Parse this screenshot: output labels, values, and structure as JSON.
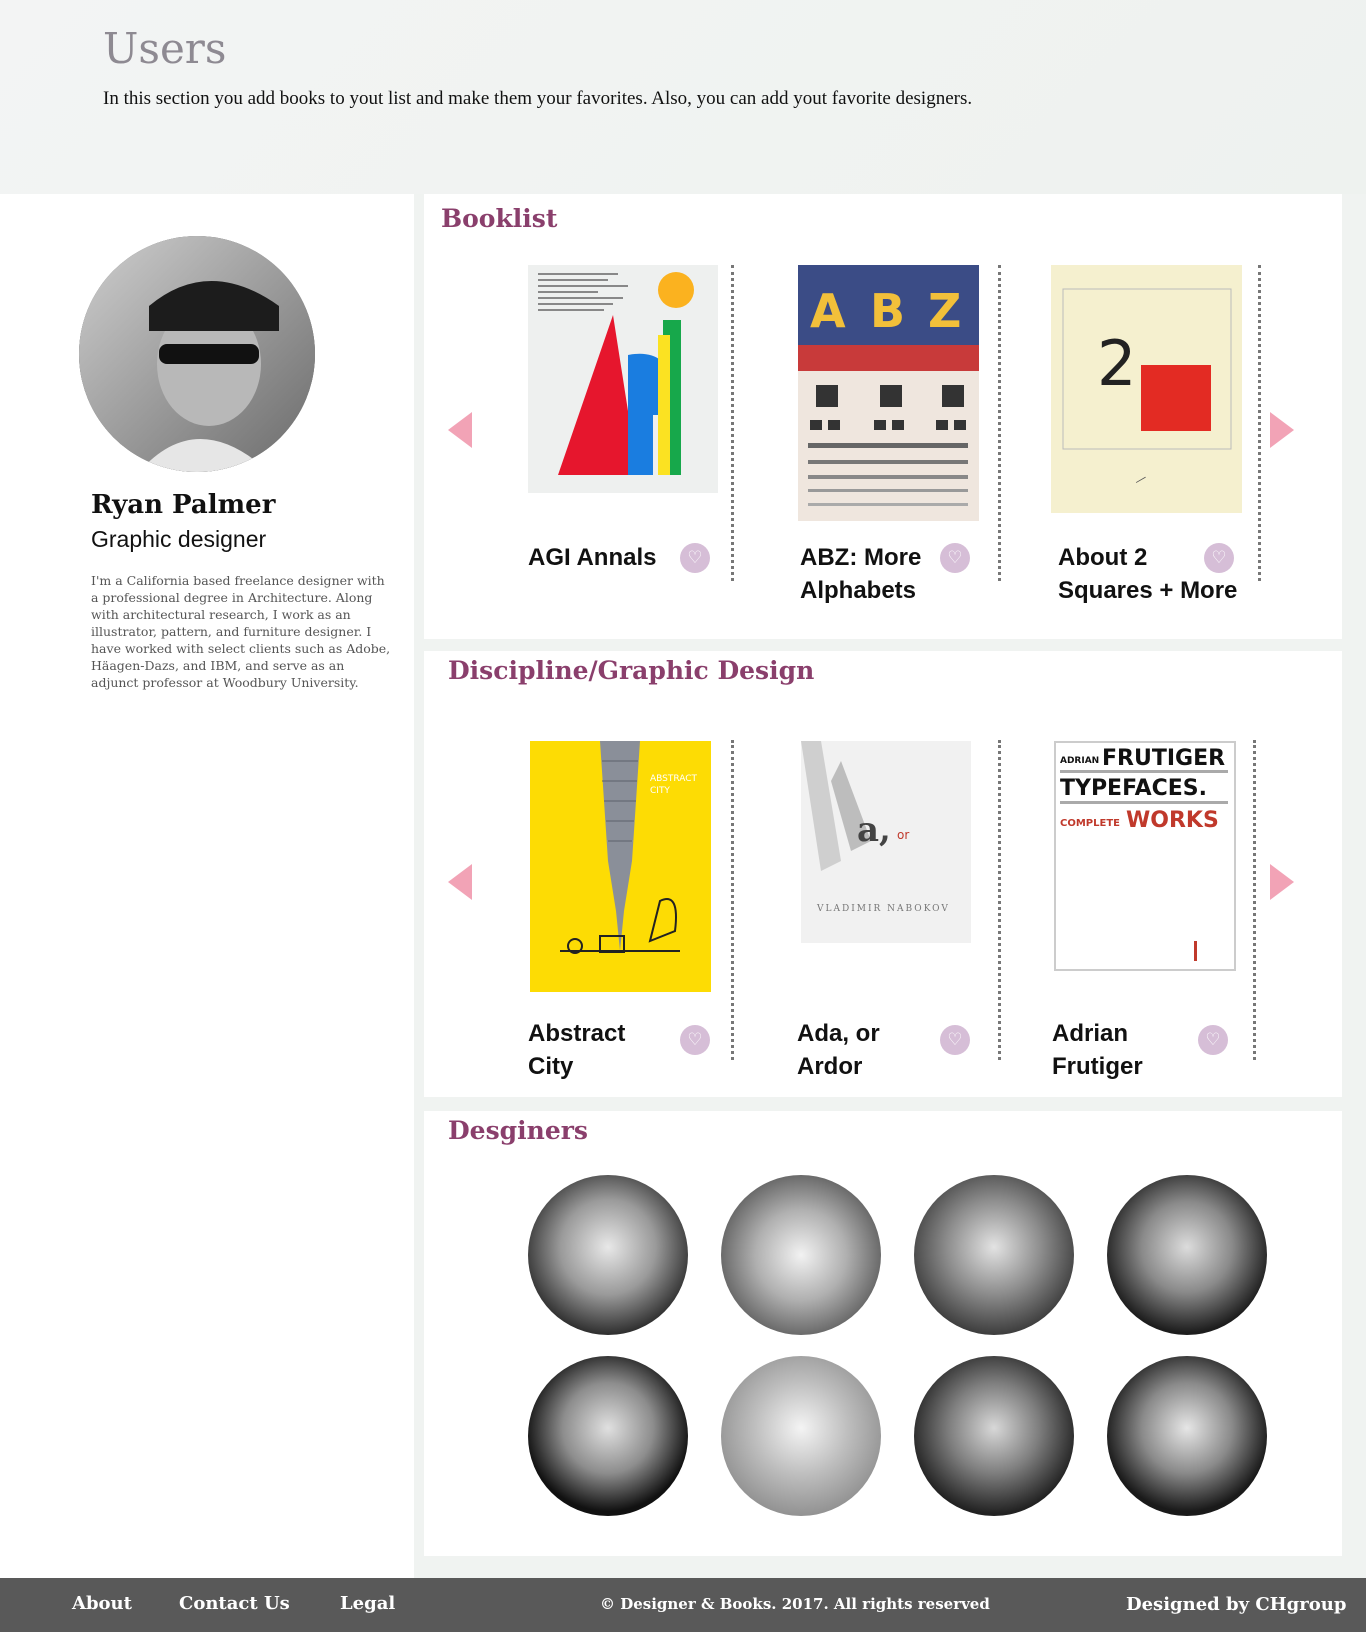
{
  "header": {
    "title": "Users",
    "intro": "In this section you add books to yout list and make them your favorites. Also, you can add yout favorite designers."
  },
  "profile": {
    "name": "Ryan Palmer",
    "role": "Graphic designer",
    "bio": "I'm a California based freelance designer with a professional degree in Architecture. Along with architectural research, I work as an illustrator, pattern, and furniture designer. I have worked with select clients such as Adobe, Häagen-Dazs, and IBM, and serve as an adjunct professor at Woodbury University."
  },
  "booklist": {
    "title": "Booklist",
    "books": [
      {
        "title": "AGI Annals"
      },
      {
        "title": "ABZ: More Alphabets"
      },
      {
        "title": "About 2 Squares + More"
      }
    ]
  },
  "discipline": {
    "title": "Discipline/Graphic Design",
    "books": [
      {
        "title": "Abstract City"
      },
      {
        "title": "Ada, or Ardor"
      },
      {
        "title": "Adrian Frutiger"
      }
    ]
  },
  "designers": {
    "title": "Desginers"
  },
  "footer": {
    "about": "About",
    "contact": "Contact Us",
    "legal": "Legal",
    "copyright": "© Designer & Books. 2017. All rights reserved",
    "credit": "Designed by CHgroup"
  },
  "colors": {
    "accent": "#8a3f6c",
    "arrow": "#f2a3b6",
    "favorite": "#d6bed7",
    "footer": "#595959"
  },
  "icons": {
    "prev": "triangle-left-icon",
    "next": "triangle-right-icon",
    "favorite": "heart-icon"
  }
}
